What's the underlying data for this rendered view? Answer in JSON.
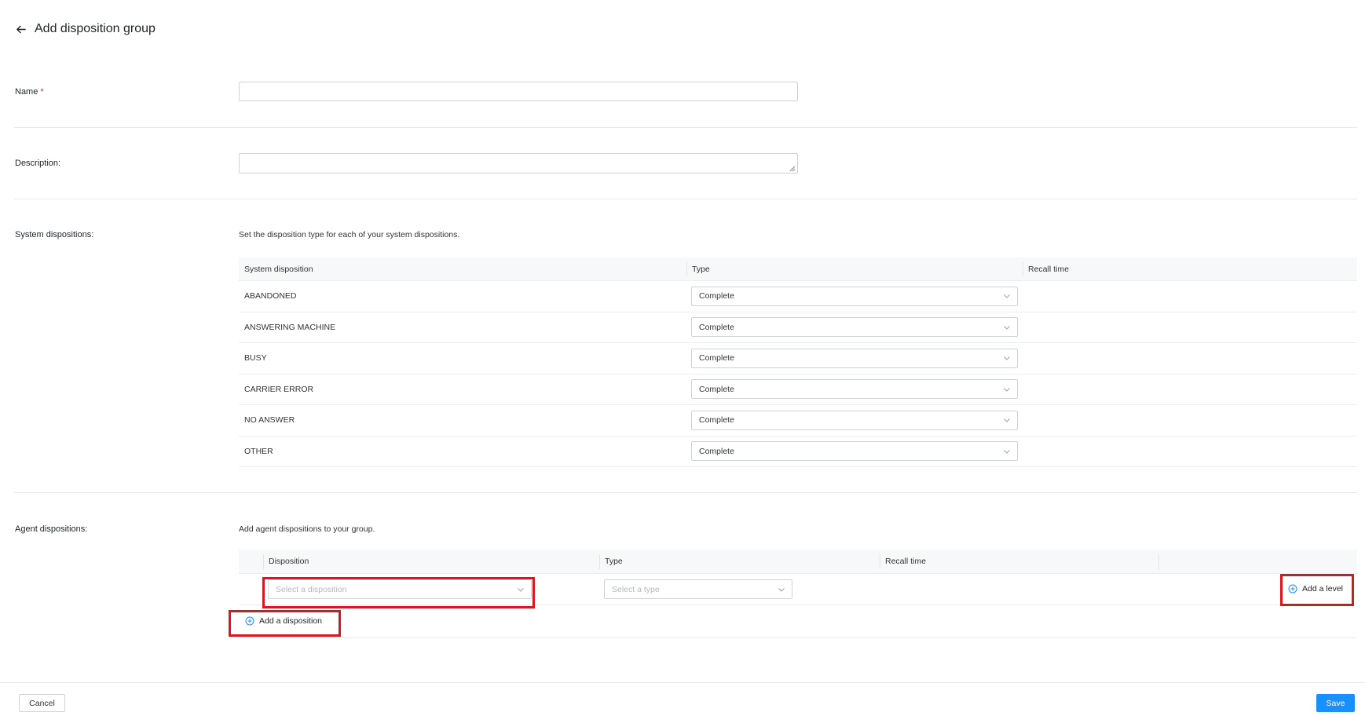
{
  "header": {
    "title": "Add disposition group"
  },
  "form": {
    "name_label": "Name",
    "name_required": "*",
    "name_value": "",
    "description_label": "Description:",
    "description_value": ""
  },
  "system": {
    "label": "System dispositions:",
    "hint": "Set the disposition type for each of your system dispositions.",
    "columns": [
      "System disposition",
      "Type",
      "Recall time"
    ],
    "rows": [
      {
        "name": "ABANDONED",
        "type": "Complete"
      },
      {
        "name": "ANSWERING MACHINE",
        "type": "Complete"
      },
      {
        "name": "BUSY",
        "type": "Complete"
      },
      {
        "name": "CARRIER ERROR",
        "type": "Complete"
      },
      {
        "name": "NO ANSWER",
        "type": "Complete"
      },
      {
        "name": "OTHER",
        "type": "Complete"
      }
    ]
  },
  "agent": {
    "label": "Agent dispositions:",
    "hint": "Add agent dispositions to your group.",
    "columns": [
      "Disposition",
      "Type",
      "Recall time"
    ],
    "disposition_placeholder": "Select a disposition",
    "type_placeholder": "Select a type",
    "add_level": "Add a level",
    "add_disposition": "Add a disposition"
  },
  "footer": {
    "cancel": "Cancel",
    "save": "Save"
  },
  "colors": {
    "primary": "#1890ff",
    "highlight": "#e0141e",
    "required": "#e0282e"
  },
  "icons": {
    "back": "arrow-left",
    "chevron": "chevron-down",
    "add": "plus-circle"
  }
}
